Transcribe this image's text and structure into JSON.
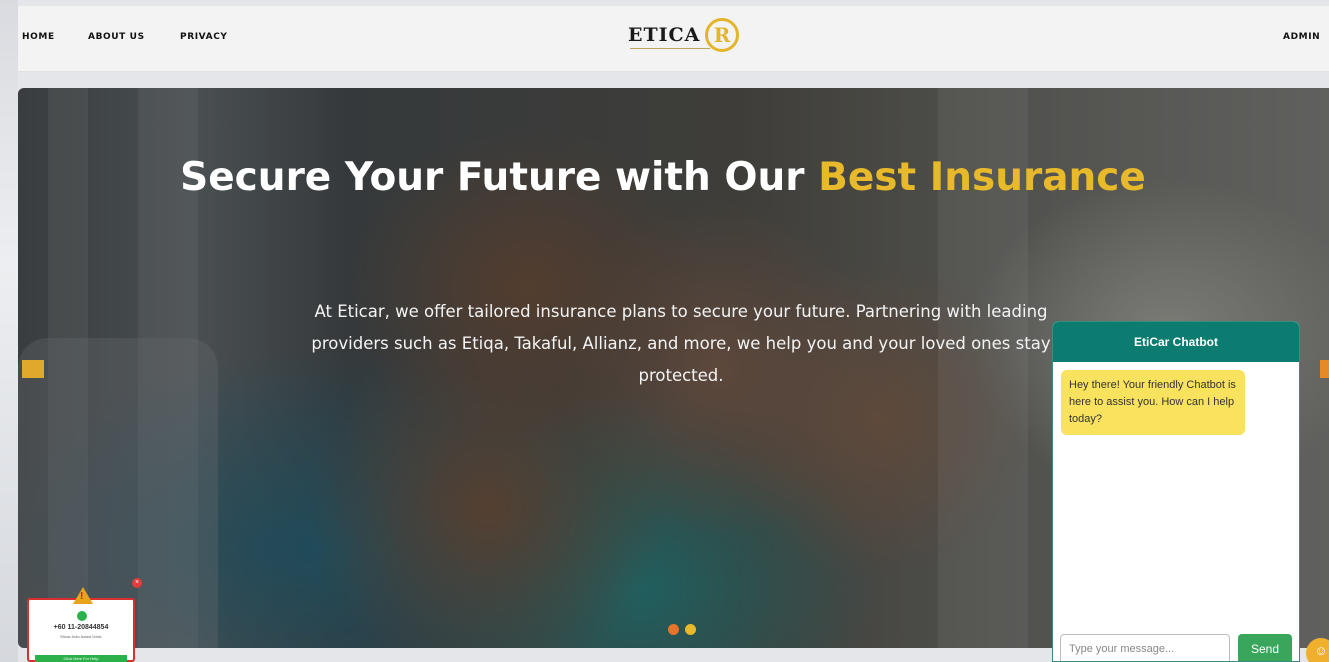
{
  "nav": {
    "home": "HOME",
    "about": "ABOUT US",
    "privacy": "PRIVACY",
    "admin": "ADMIN"
  },
  "logo": {
    "text": "ETICA",
    "r_mark": "R"
  },
  "hero": {
    "title_part1": "Secure Your Future with Our ",
    "title_accent": "Best Insurance",
    "description": "At Eticar, we offer tailored insurance plans to secure your future. Partnering with leading providers such as Etiqa, Takaful, Allianz, and more, we help you and your loved ones stay protected.",
    "slide_count": 2,
    "active_slide": 1
  },
  "chatbot": {
    "title": "EtiCar Chatbot",
    "greeting": "Hey there! Your friendly Chatbot is here to assist you. How can I help today?",
    "input_placeholder": "Type your message...",
    "send_label": "Send"
  },
  "whatsapp_widget": {
    "phone": "+60 11-20844854",
    "subtitle": "Eticar Auto Assist Desk",
    "button_label": "Click Here For Help"
  },
  "colors": {
    "accent_gold": "#e8b92a",
    "chat_header": "#0c7c70",
    "send_green": "#3aa65b",
    "chat_bubble": "#f9e35e"
  },
  "icons": {
    "chat_fab": "chat-bubble-icon",
    "whatsapp": "whatsapp-icon",
    "warning": "warning-icon"
  }
}
